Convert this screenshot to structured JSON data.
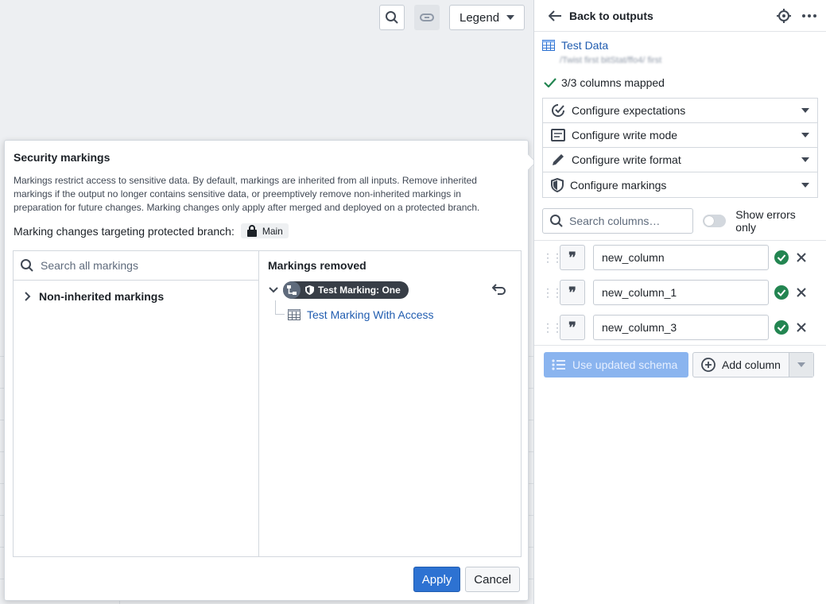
{
  "toolbar": {
    "legend_label": "Legend"
  },
  "popover": {
    "title": "Security markings",
    "description": "Markings restrict access to sensitive data. By default, markings are inherited from all inputs. Remove inherited markings if the output no longer contains sensitive data, or preemptively remove non-inherited markings in preparation for future changes. Marking changes only apply after merged and deployed on a protected branch.",
    "branch_label": "Marking changes targeting protected branch:",
    "branch_name": "Main",
    "search_placeholder": "Search all markings",
    "tree_item": "Non-inherited markings",
    "removed_title": "Markings removed",
    "marking_pill": "Test Marking: One",
    "marking_child": "Test Marking With Access",
    "apply_label": "Apply",
    "cancel_label": "Cancel"
  },
  "panel": {
    "back_label": "Back to outputs",
    "dataset_title": "Test Data",
    "dataset_path": "/Twist first bitStat/ffo4/ first",
    "mapped_text": "3/3 columns mapped",
    "config_items": [
      {
        "label": "Configure expectations",
        "icon": "expectations-icon"
      },
      {
        "label": "Configure write mode",
        "icon": "write-mode-icon"
      },
      {
        "label": "Configure write format",
        "icon": "pencil-icon"
      },
      {
        "label": "Configure markings",
        "icon": "shield-icon"
      }
    ],
    "search_placeholder": "Search columns…",
    "show_errors_label": "Show errors only",
    "columns": [
      {
        "name": "new_column"
      },
      {
        "name": "new_column_1"
      },
      {
        "name": "new_column_3"
      }
    ],
    "use_schema_label": "Use updated schema",
    "add_column_label": "Add column"
  },
  "colors": {
    "primary": "#2d72d2",
    "success": "#238551",
    "link": "#215db0",
    "pill": "#383e47"
  }
}
